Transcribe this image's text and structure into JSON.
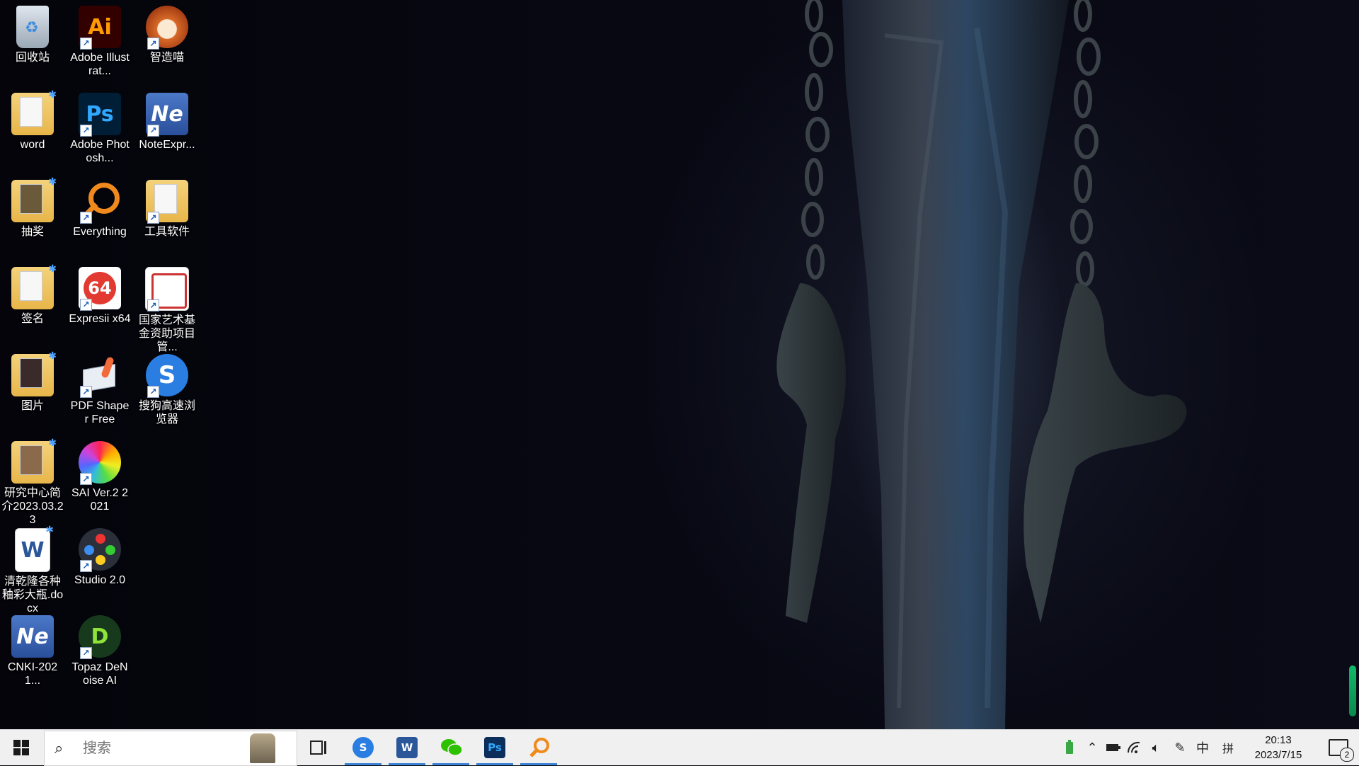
{
  "desktop_icons": [
    {
      "label": "回收站",
      "icon": "recycle-bin-icon"
    },
    {
      "label": "Adobe Illustrat...",
      "icon": "adobe-illustrator-icon",
      "logo_text": "Ai"
    },
    {
      "label": "智造喵",
      "icon": "zhizaomiao-icon"
    },
    {
      "label": "word",
      "icon": "folder-icon"
    },
    {
      "label": "Adobe Photosh...",
      "icon": "adobe-photoshop-icon",
      "logo_text": "Ps"
    },
    {
      "label": "NoteExpr...",
      "icon": "noteexpress-icon",
      "logo_text": "Ne"
    },
    {
      "label": "抽奖",
      "icon": "folder-icon"
    },
    {
      "label": "Everything",
      "icon": "everything-search-icon"
    },
    {
      "label": "工具软件",
      "icon": "folder-icon"
    },
    {
      "label": "签名",
      "icon": "folder-icon"
    },
    {
      "label": "Expresii x64",
      "icon": "expresii-icon",
      "logo_text": "64"
    },
    {
      "label": "国家艺术基金资助项目管...",
      "icon": "art-fund-seal-icon"
    },
    {
      "label": "图片",
      "icon": "folder-icon"
    },
    {
      "label": "PDF Shaper Free",
      "icon": "pdf-shaper-icon"
    },
    {
      "label": "搜狗高速浏览器",
      "icon": "sogou-browser-icon",
      "logo_text": "S"
    },
    {
      "label": "研究中心简介2023.03.23",
      "icon": "folder-icon"
    },
    {
      "label": "SAI Ver.2 2021",
      "icon": "sai-color-wheel-icon"
    },
    {
      "label": "清乾隆各种釉彩大瓶.docx",
      "icon": "word-document-icon",
      "logo_text": "W"
    },
    {
      "label": "Studio 2.0",
      "icon": "studio-icon"
    },
    {
      "label": "CNKI-2021...",
      "icon": "cnki-noteexpress-icon",
      "logo_text": "Ne"
    },
    {
      "label": "Topaz DeNoise AI",
      "icon": "topaz-denoise-icon",
      "logo_text": "D"
    }
  ],
  "taskbar": {
    "search_placeholder": "搜索",
    "apps": [
      {
        "name": "task-view",
        "icon": "task-view-icon"
      },
      {
        "name": "sogou-browser",
        "icon": "sogou-browser-icon",
        "text": "S",
        "color": "#2a7de1"
      },
      {
        "name": "word",
        "icon": "word-icon",
        "text": "W",
        "color": "#2b579a"
      },
      {
        "name": "wechat",
        "icon": "wechat-icon",
        "text": "",
        "color": "#2dc100"
      },
      {
        "name": "photoshop",
        "icon": "photoshop-icon",
        "text": "Ps",
        "color": "#0c2e5a"
      },
      {
        "name": "everything",
        "icon": "everything-icon",
        "text": "",
        "color": "#f08a1c"
      }
    ],
    "tray": {
      "ime_lang": "中",
      "ime_mode": "拼"
    },
    "clock": {
      "time": "20:13",
      "date": "2023/7/15"
    },
    "notification_count": "2"
  }
}
